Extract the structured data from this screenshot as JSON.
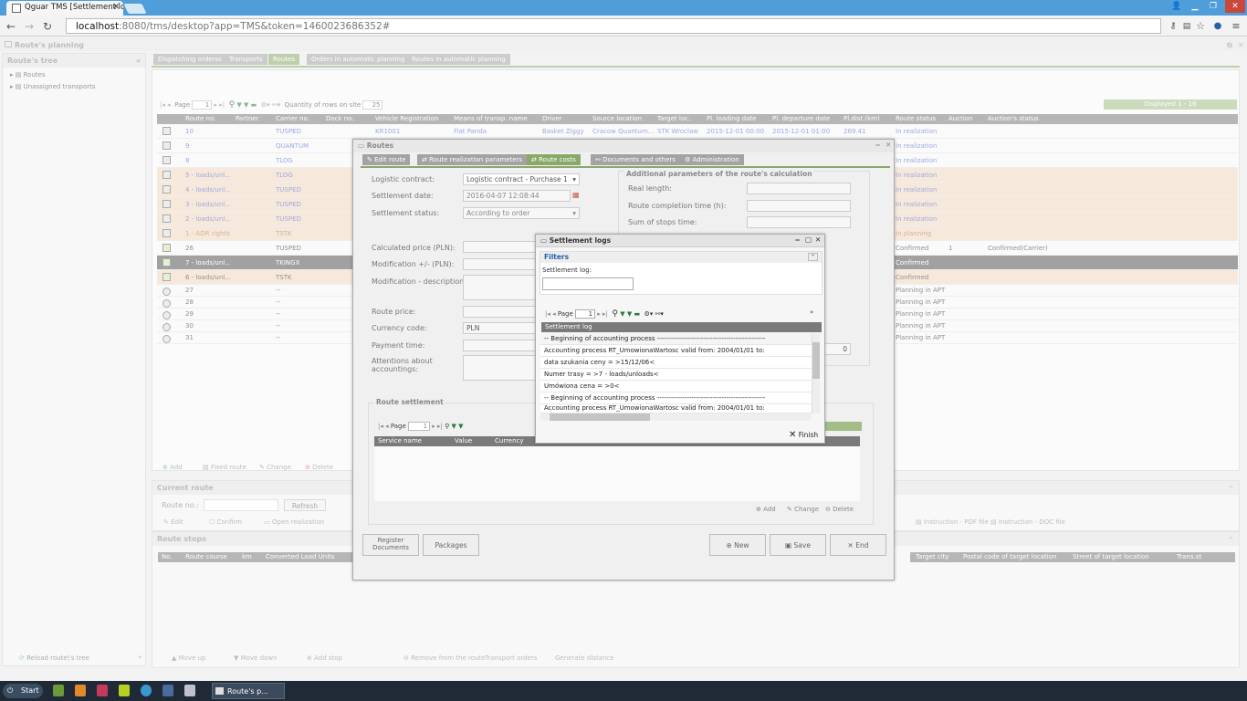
{
  "browser": {
    "tab_title": "Qguar TMS [Settlement lo",
    "url_host": "localhost",
    "url_rest": ":8080/tms/desktop?app=TMS&token=1460023686352#"
  },
  "app": {
    "title": "Route's planning",
    "tree": {
      "header": "Route's tree",
      "items": [
        "Routes",
        "Unassigned transports"
      ],
      "reload": "Reload route\\'s tree"
    },
    "tabs": [
      "Dispatching orderss",
      "Transports",
      "Routes",
      "Orders in automatic planning",
      "Routes in automatic planning"
    ],
    "grid": {
      "page_label": "Page",
      "page": "1",
      "quantity_label": "Quantity of rows on site",
      "quantity": "25",
      "displayed": "Displayed 1 - 16",
      "columns": [
        "Route no.",
        "Partner",
        "Carrier no.",
        "Dock no.",
        "Vehicle Registration",
        "Means of transp. name",
        "Driver",
        "Source location",
        "Target loc.",
        "Pl. loading date",
        "Pl. departure date",
        "Pl.dist.(km)",
        "Route status",
        "Auction",
        "Auction's status"
      ],
      "rows": [
        {
          "route": "10",
          "carrier": "TUSPED",
          "vehicle": "KR1001",
          "means": "Fiat Panda",
          "driver": "Basket Ziggy",
          "source": "Cracow Quantum...",
          "target": "STK Wroclaw",
          "loading": "2015-12-01 00:00",
          "departure": "2015-12-01 01:00",
          "dist": "269.41",
          "status": "In realization",
          "auction": "",
          "auction_status": ""
        },
        {
          "route": "9",
          "carrier": "QUANTUM",
          "status": "In realization"
        },
        {
          "route": "8",
          "carrier": "TLOG",
          "status": "In realization"
        },
        {
          "route": "5 - loads/unl...",
          "carrier": "TLOG",
          "status": "In realization"
        },
        {
          "route": "4 - loads/unl...",
          "carrier": "TUSPED",
          "status": "In realization"
        },
        {
          "route": "3 - loads/unl...",
          "carrier": "TUSPED",
          "status": "In realization"
        },
        {
          "route": "2 - loads/unl...",
          "carrier": "TUSPED",
          "status": "In realization"
        },
        {
          "route": "1 - ADR rights",
          "carrier": "TSTK",
          "status": "In planning"
        },
        {
          "route": "26",
          "carrier": "TUSPED",
          "status": "Confirmed",
          "auction": "1",
          "auction_status": "Confirmed(Carrier)"
        },
        {
          "route": "7 - loads/unl...",
          "carrier": "TKINGX",
          "status": "Confirmed"
        },
        {
          "route": "6 - loads/unl...",
          "carrier": "TSTK",
          "status": "Confirmed"
        },
        {
          "route": "27",
          "carrier": "--",
          "status": "Planning in APT"
        },
        {
          "route": "28",
          "carrier": "--",
          "status": "Planning in APT"
        },
        {
          "route": "29",
          "carrier": "--",
          "status": "Planning in APT"
        },
        {
          "route": "30",
          "carrier": "--",
          "status": "Planning in APT"
        },
        {
          "route": "31",
          "carrier": "--",
          "status": "Planning in APT"
        }
      ],
      "actions": [
        "Add",
        "Fixed route",
        "Change",
        "Delete"
      ]
    },
    "current_route": {
      "header": "Current route",
      "route_no_label": "Route no.:",
      "refresh": "Refresh",
      "actions": [
        "Edit",
        "Confirm",
        "Open realization"
      ],
      "instr_pdf": "Instruction - PDF file",
      "instr_doc": "Instruction - DOC file"
    },
    "route_stops": {
      "header": "Route stops",
      "columns": [
        "No.",
        "Route course",
        "km",
        "Converted Load Units"
      ],
      "right_columns": [
        "Target city",
        "Postal code of target location",
        "Street of target location",
        "Trans.st"
      ],
      "bottom": [
        "Move up",
        "Move down",
        "Add stop",
        "Remove from the route",
        "Transport orders",
        "Generate distance"
      ]
    }
  },
  "routes_modal": {
    "title": "Routes",
    "tabs": [
      "Edit route",
      "Route realization parameters",
      "Route costs",
      "Documents and others",
      "Administration"
    ],
    "logistic_contract_label": "Logistic contract:",
    "logistic_contract": "Logistic contract - Purchase 1",
    "settlement_date_label": "Settlement date:",
    "settlement_date": "2016-04-07 12:08:44",
    "settlement_status_label": "Settlement status:",
    "settlement_status": "According to order",
    "calc_price_label": "Calculated price (PLN):",
    "modification_label": "Modification +/- (PLN):",
    "modification_desc_label": "Modification - description:",
    "route_price_label": "Route price:",
    "currency_label": "Currency code:",
    "currency": "PLN",
    "payment_label": "Payment time:",
    "attentions_label": "Attentions about accountings:",
    "additional_header": "Additional parameters of the route's calculation",
    "real_length_label": "Real length:",
    "completion_label": "Route completion time (h):",
    "stops_time_label": "Sum of stops time:",
    "extra_value": "0",
    "settlement_header": "Route settlement",
    "page_label": "Page",
    "page": "1",
    "settlement_columns": [
      "Service name",
      "Value",
      "Currency"
    ],
    "add": "Add",
    "change": "Change",
    "delete": "Delete",
    "register_docs": "Register Documents",
    "packages": "Packages",
    "new": "New",
    "save": "Save",
    "end": "End"
  },
  "log_modal": {
    "title": "Settlement logs",
    "filters": "Filters",
    "log_label": "Settlement log:",
    "page_label": "Page",
    "page": "1",
    "column": "Settlement log",
    "rows": [
      "-- Beginning of accounting process -----------------------------------------------",
      "Accounting process RT_UmowionaWartosc valid from: 2004/01/01 to:",
      "data szukania ceny = >15/12/06<",
      "Numer trasy = >7 - loads/unloads<",
      "Umówiona cena = >0<",
      "-- Beginning of accounting process -----------------------------------------------",
      "Accounting process RT_UmowionaWartosc valid from: 2004/01/01 to:"
    ],
    "finish": "Finish"
  },
  "taskbar": {
    "start": "Start",
    "task": "Route's p..."
  },
  "colors": {
    "chrome_blue": "#4f9ed9",
    "active_green": "#8aa86a",
    "planned_orange": "#f1d6c0",
    "selected_dark": "#555555",
    "link_blue": "#4a63c9"
  }
}
